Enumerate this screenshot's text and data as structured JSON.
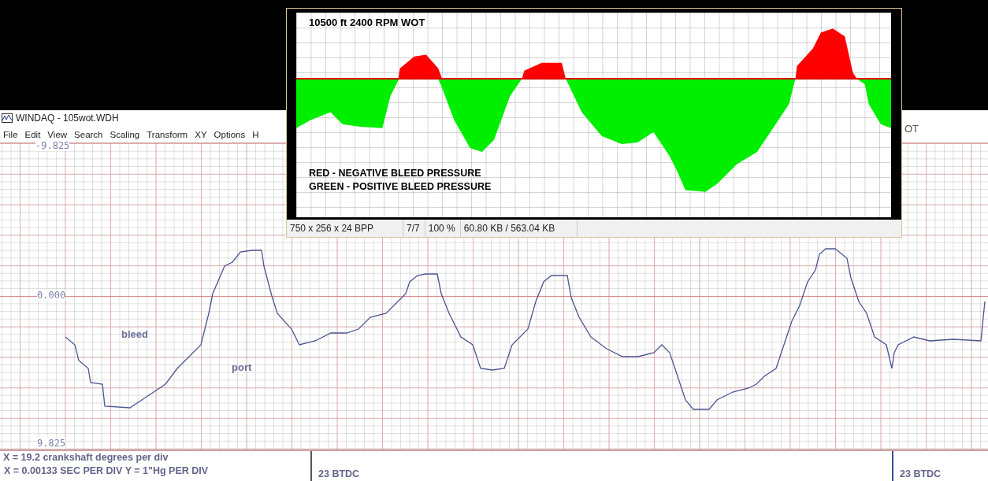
{
  "background_window": {
    "title": "WINDAQ - 105wot.WDH",
    "menu": [
      "File",
      "Edit",
      "View",
      "Search",
      "Scaling",
      "Transform",
      "XY",
      "Options",
      "H"
    ],
    "title_fragment": "OT",
    "plot": {
      "y_labels": [
        "-9.825",
        "0.000",
        "9.825"
      ],
      "trace_labels": [
        "bleed",
        "port"
      ]
    },
    "footer": {
      "lines": [
        "X = 19.2 crankshaft degrees per div",
        "X = 0.00133 SEC PER DIV   Y = 1\"Hg PER DIV"
      ],
      "markers": [
        "23 BTDC",
        "23 BTDC"
      ]
    }
  },
  "image_viewer": {
    "image": {
      "title": "10500 ft 2400 RPM WOT",
      "legend": [
        "RED - NEGATIVE BLEED PRESSURE",
        "GREEN - POSITIVE BLEED PRESSURE"
      ]
    },
    "status": [
      "750 x 256 x 24 BPP",
      "7/7",
      "100 %",
      "60.80 KB / 563.04 KB"
    ]
  }
}
